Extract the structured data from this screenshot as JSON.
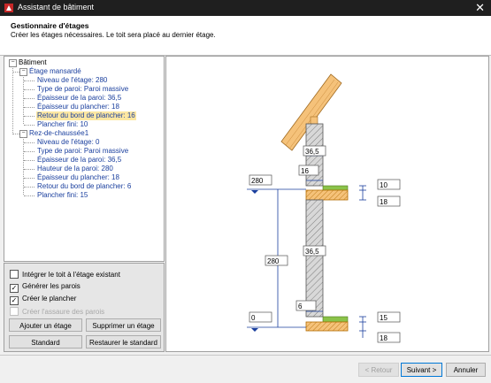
{
  "window": {
    "title": "Assistant de bâtiment",
    "close_glyph": "✕"
  },
  "header": {
    "title": "Gestionnaire d'étages",
    "subtitle": "Créer les étages nécessaires. Le toit sera placé au dernier étage."
  },
  "tree": {
    "root": "Bâtiment",
    "floors": [
      {
        "label": "Étage mansardé",
        "items": [
          "Niveau de l'étage: 280",
          "Type de paroi: Paroi massive",
          "Épaisseur de la paroi: 36,5",
          "Épaisseur du plancher: 18",
          "Retour du bord de plancher: 16",
          "Plancher fini: 10"
        ]
      },
      {
        "label": "Rez-de-chaussée1",
        "items": [
          "Niveau de l'étage: 0",
          "Type de paroi: Paroi massive",
          "Épaisseur de la paroi: 36,5",
          "Hauteur de la paroi: 280",
          "Épaisseur du plancher: 18",
          "Retour du bord de plancher: 6",
          "Plancher fini: 15"
        ]
      }
    ],
    "selected": "Retour du bord de plancher: 16"
  },
  "options": {
    "integrate_roof": "Intégrer le toit à l'étage existant",
    "generate_walls": "Générer les parois",
    "create_floor": "Créer le plancher",
    "create_framing": "Créer l'assaure des parois",
    "add_floor": "Ajouter un étage",
    "delete_floor": "Supprimer un étage",
    "standard": "Standard",
    "restore_standard": "Restaurer le standard"
  },
  "preview": {
    "upper_wall_thickness": "36,5",
    "upper_floor_return": "16",
    "upper_level": "280",
    "upper_finish": "10",
    "upper_slab": "18",
    "wall_height": "280",
    "lower_wall_thickness": "36,5",
    "lower_floor_return": "6",
    "lower_level": "0",
    "lower_finish": "15",
    "lower_slab": "18"
  },
  "footer": {
    "back": "< Retour",
    "next": "Suivant >",
    "cancel": "Annuler"
  },
  "colors": {
    "accent": "#0078d7",
    "selection": "#fde7a2",
    "tree_text": "#1a3f9e",
    "finish": "#8bc34a",
    "slab": "#f5c27a"
  }
}
